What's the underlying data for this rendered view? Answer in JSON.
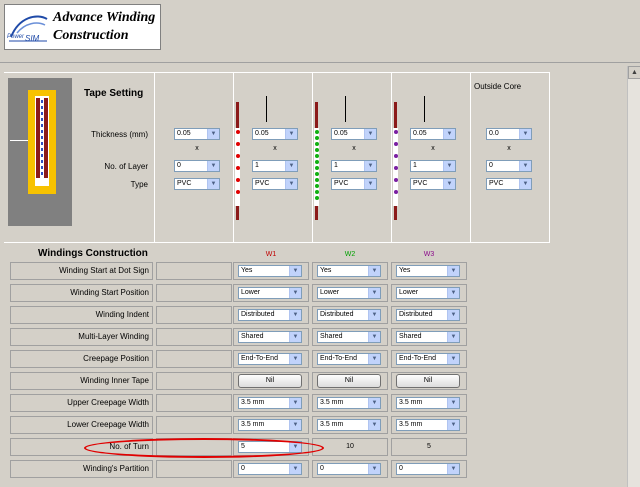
{
  "app": {
    "title_line1": "Advance Winding",
    "title_line2": "Construction",
    "logo_text_1": "Power",
    "logo_text_2": "SIM"
  },
  "tape": {
    "heading": "Tape Setting",
    "outside_core": "Outside Core",
    "thickness_label": "Thickness (mm)",
    "layer_label": "No. of Layer",
    "type_label": "Type",
    "x": "x",
    "columns": [
      {
        "thickness": "0.05",
        "layers": "0",
        "type": "PVC"
      },
      {
        "thickness": "0.05",
        "layers": "1",
        "type": "PVC"
      },
      {
        "thickness": "0.05",
        "layers": "1",
        "type": "PVC"
      },
      {
        "thickness": "0.05",
        "layers": "1",
        "type": "PVC"
      },
      {
        "thickness": "0.0",
        "layers": "0",
        "type": "PVC"
      }
    ]
  },
  "windings": {
    "heading": "Windings Construction",
    "names": [
      "W1",
      "W2",
      "W3"
    ],
    "name_colors": [
      "#c00000",
      "#00a000",
      "#8b0a8b"
    ],
    "dot_colors": [
      "#e00000",
      "#10b010",
      "#7a1fa2"
    ],
    "rows": [
      {
        "label": "Winding Start at Dot Sign",
        "values": [
          "Yes",
          "Yes",
          "Yes"
        ],
        "kind": "select"
      },
      {
        "label": "Winding Start Position",
        "values": [
          "Lower",
          "Lower",
          "Lower"
        ],
        "kind": "select"
      },
      {
        "label": "Winding Indent",
        "values": [
          "Distributed",
          "Distributed",
          "Distributed"
        ],
        "kind": "select"
      },
      {
        "label": "Multi-Layer Winding",
        "values": [
          "Shared",
          "Shared",
          "Shared"
        ],
        "kind": "select"
      },
      {
        "label": "Creepage Position",
        "values": [
          "End-To-End",
          "End-To-End",
          "End-To-End"
        ],
        "kind": "select"
      },
      {
        "label": "Winding Inner Tape",
        "values": [
          "Nil",
          "Nil",
          "Nil"
        ],
        "kind": "button"
      },
      {
        "label": "Upper Creepage Width",
        "values": [
          "3.5 mm",
          "3.5 mm",
          "3.5 mm"
        ],
        "kind": "select"
      },
      {
        "label": "Lower Creepage Width",
        "values": [
          "3.5 mm",
          "3.5 mm",
          "3.5 mm"
        ],
        "kind": "select"
      },
      {
        "label": "No. of Turn",
        "values": [
          "5",
          "10",
          "5"
        ],
        "kind": "mixed"
      },
      {
        "label": "Winding's Partition",
        "values": [
          "0",
          "0",
          "0"
        ],
        "kind": "select"
      }
    ]
  },
  "icons": {
    "dropdown": "chevron-down-icon",
    "scroll_up": "arrow-up-icon"
  }
}
